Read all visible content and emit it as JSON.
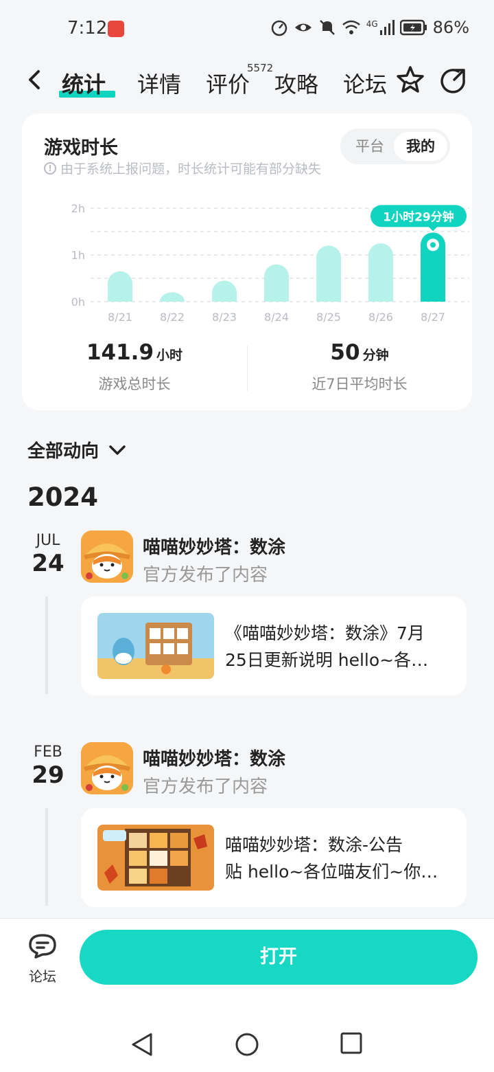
{
  "status_bar": {
    "time": "7:12",
    "signal": "4G",
    "battery": "86%"
  },
  "nav": {
    "tabs": [
      {
        "label": "统计",
        "active": true
      },
      {
        "label": "详情"
      },
      {
        "label": "评价",
        "badge": "5572"
      },
      {
        "label": "攻略"
      },
      {
        "label": "论坛"
      }
    ]
  },
  "stats_card": {
    "title": "游戏时长",
    "note": "由于系统上报问题，时长统计可能有部分缺失",
    "toggle": {
      "option1": "平台",
      "option2": "我的"
    },
    "summary": {
      "total_value": "141.9",
      "total_unit": "小时",
      "total_label": "游戏总时长",
      "avg_value": "50",
      "avg_unit": "分钟",
      "avg_label": "近7日平均时长"
    }
  },
  "chart_data": {
    "type": "bar",
    "categories": [
      "8/21",
      "8/22",
      "8/23",
      "8/24",
      "8/25",
      "8/26",
      "8/27"
    ],
    "values": [
      0.65,
      0.2,
      0.45,
      0.8,
      1.2,
      1.25,
      1.48
    ],
    "unit": "hours",
    "yticks": [
      "0h",
      "1h",
      "2h"
    ],
    "ylim": [
      0,
      2
    ],
    "highlight_index": 6,
    "highlight_label": "1小时29分钟",
    "colors": {
      "bar": "#b7f2ea",
      "highlight": "#11d4c0"
    }
  },
  "activity": {
    "filter_label": "全部动向",
    "year": "2024",
    "entries": [
      {
        "month": "JUL",
        "day": "24",
        "game_name": "喵喵妙妙塔：数涂",
        "subtitle": "官方发布了内容",
        "post_line1": "《喵喵妙妙塔：数涂》7月",
        "post_line2": "25日更新说明 hello~各…"
      },
      {
        "month": "FEB",
        "day": "29",
        "game_name": "喵喵妙妙塔：数涂",
        "subtitle": "官方发布了内容",
        "post_line1": "喵喵妙妙塔：数涂-公告",
        "post_line2": "贴 hello~各位喵友们~你…"
      }
    ]
  },
  "bottom_bar": {
    "forum_label": "论坛",
    "open_label": "打开"
  }
}
